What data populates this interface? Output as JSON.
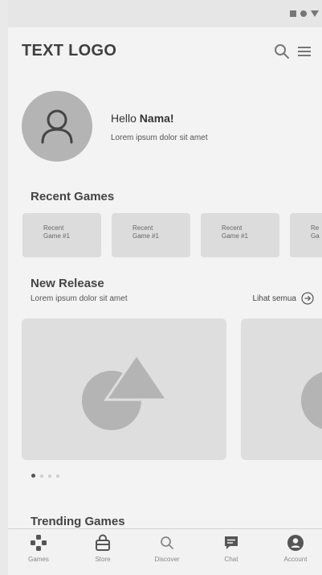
{
  "header": {
    "logo": "TEXT LOGO"
  },
  "profile": {
    "greeting_prefix": "Hello ",
    "name": "Nama!",
    "subtitle": "Lorem ipsum dolor sit amet"
  },
  "recent_games": {
    "title": "Recent Games",
    "items": [
      {
        "line1": "Recent",
        "line2": "Game #1"
      },
      {
        "line1": "Recent",
        "line2": "Game #1"
      },
      {
        "line1": "Recent",
        "line2": "Game #1"
      },
      {
        "line1": "Re",
        "line2": "Ga"
      }
    ]
  },
  "new_release": {
    "title": "New Release",
    "subtitle": "Lorem ipsum dolor sit amet",
    "see_all": "Lihat semua"
  },
  "trending": {
    "title": "Trending Games"
  },
  "nav": {
    "items": [
      {
        "label": "Games",
        "icon": "gamepad-icon"
      },
      {
        "label": "Store",
        "icon": "store-icon"
      },
      {
        "label": "Discover",
        "icon": "search-icon"
      },
      {
        "label": "Chat",
        "icon": "chat-icon"
      },
      {
        "label": "Account",
        "icon": "account-icon"
      }
    ]
  }
}
